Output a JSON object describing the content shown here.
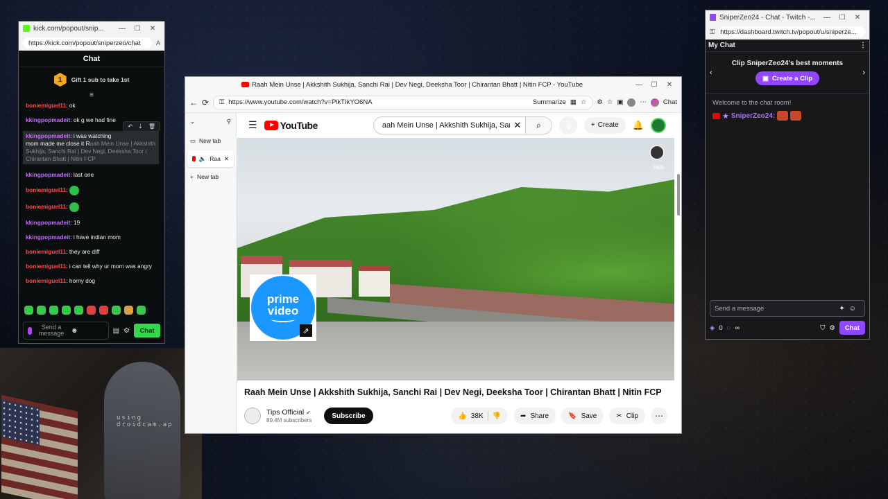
{
  "kick": {
    "tab_title": "kick.com/popout/snip...",
    "url": "https://kick.com/popout/sniperzeo/chat",
    "panel_title": "Chat",
    "gift": {
      "badge": "1",
      "text": "Gift 1 sub to take 1st"
    },
    "messages": [
      {
        "user": "boniemiguel11",
        "text": ": ok",
        "color": "red"
      },
      {
        "user": "kkingpopmadeit",
        "text": ": ok g we had fine",
        "color": "purple"
      },
      {
        "user": "kkingpopmadeit",
        "text": ": i was watching ",
        "extra": "mom made me close it R",
        "selected": "aah Mein Unse | Akkshith Sukhija, Sanchi Rai | Dev Negi, Deeksha Toor | Chirantan Bhatt | Nitin FCP",
        "color": "purple"
      },
      {
        "user": "kkingpopmadeit",
        "text": ": last one",
        "color": "purple"
      },
      {
        "user": "boniemiguel11",
        "text": ":",
        "color": "red",
        "emote": true
      },
      {
        "user": "boniemiguel11",
        "text": ":",
        "color": "red",
        "emote": true
      },
      {
        "user": "kkingpopmadeit",
        "text": ": 19",
        "color": "purple"
      },
      {
        "user": "kkingpopmadeit",
        "text": ": i have indian mom",
        "color": "purple"
      },
      {
        "user": "boniemiguel11",
        "text": ": they are diff",
        "color": "red"
      },
      {
        "user": "boniemiguel11",
        "text": ": i can tell why ur mom was angry",
        "color": "red"
      },
      {
        "user": "boniemiguel11",
        "text": ": horny dog",
        "color": "red"
      }
    ],
    "composer": {
      "placeholder": "Send a message",
      "chat_label": "Chat"
    }
  },
  "webcam": {
    "watermark": "using droidcam.ap"
  },
  "edge": {
    "window_title": "Raah Mein Unse | Akkshith Sukhija, Sanchi Rai | Dev Negi, Deeksha Toor | Chirantan Bhatt | Nitin FCP - YouTube",
    "url": "https://www.youtube.com/watch?v=PlkTIkYO6NA",
    "summarize": "Summarize",
    "copilot_label": "Chat",
    "side_tabs": [
      {
        "label": "New tab"
      },
      {
        "label": "Raa",
        "active": true
      },
      {
        "label": "New tab",
        "plus": true
      }
    ],
    "yt": {
      "logo": "YouTube",
      "search_query": "aah Mein Unse | Akkshith Sukhija, Sanchi Rai | Dev Negi, Deeksha Toor | Chirantan Bhatt | Nitin FCP",
      "create_label": "Create",
      "prime_line1": "prime",
      "prime_line2": "video",
      "hide_label": "Hide",
      "video_title": "Raah Mein Unse | Akkshith Sukhija, Sanchi Rai | Dev Negi, Deeksha Toor | Chirantan Bhatt | Nitin FCP",
      "channel_name": "Tips Official",
      "subscribers": "80.4M subscribers",
      "subscribe_label": "Subscribe",
      "likes": "38K",
      "share_label": "Share",
      "save_label": "Save",
      "clip_label": "Clip"
    }
  },
  "twitch": {
    "window_title": "SniperZeo24 - Chat - Twitch -...",
    "url": "https://dashboard.twitch.tv/popout/u/sniperze...",
    "header": "My Chat",
    "clip_title": "Clip SniperZeo24's best moments",
    "clip_button": "Create a Clip",
    "welcome": "Welcome to the chat room!",
    "line_user": "SniperZeo24",
    "input_placeholder": "Send a message",
    "points": "0",
    "infinity": "∞",
    "chat_label": "Chat"
  }
}
